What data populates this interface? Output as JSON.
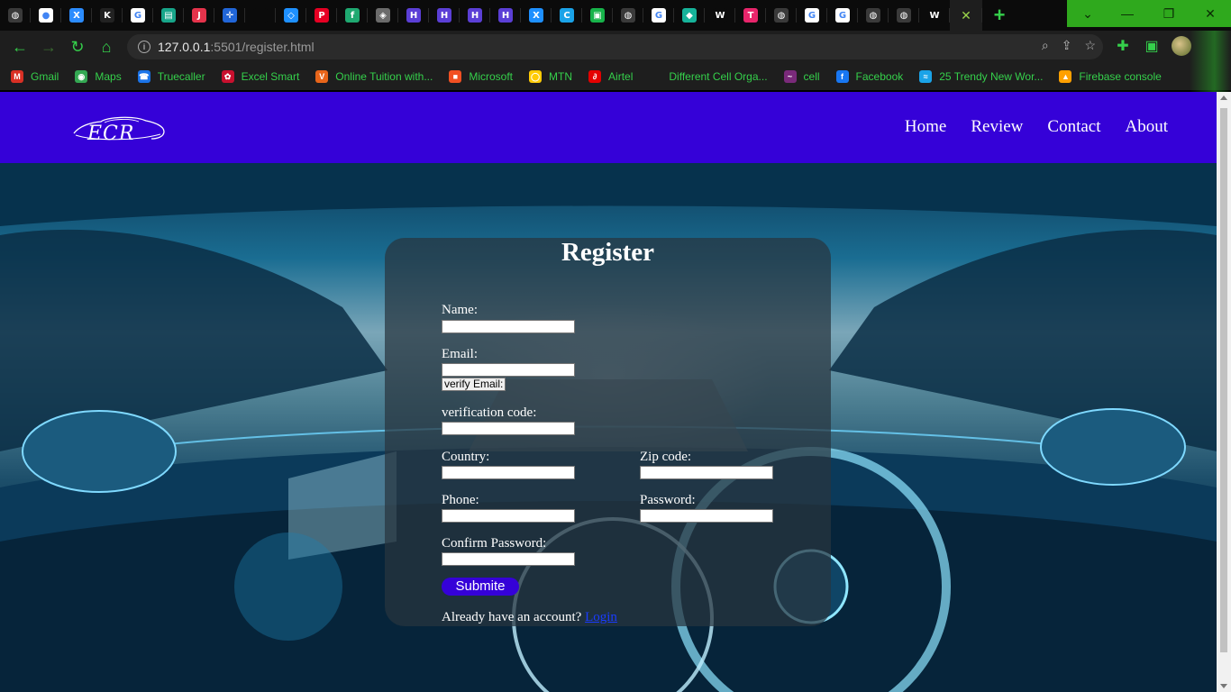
{
  "browser": {
    "tabs": [
      {
        "icon": "globe-icon",
        "color": "#3a3a3a",
        "glyph": "◍"
      },
      {
        "icon": "github-icon",
        "color": "#ffffff",
        "glyph": "●"
      },
      {
        "icon": "x-icon",
        "color": "#2b8cff",
        "glyph": "X"
      },
      {
        "icon": "k-icon",
        "color": "#222222",
        "glyph": "K"
      },
      {
        "icon": "google-icon",
        "color": "#ffffff",
        "glyph": "G"
      },
      {
        "icon": "sheet-icon",
        "color": "#17a589",
        "glyph": "▤"
      },
      {
        "icon": "j-icon",
        "color": "#e5334b",
        "glyph": "J"
      },
      {
        "icon": "jira-icon",
        "color": "#2166d8",
        "glyph": "✛"
      },
      {
        "icon": "blank-icon",
        "color": "#0b0b0b",
        "glyph": ""
      },
      {
        "icon": "code-icon",
        "color": "#1e90ff",
        "glyph": "◇"
      },
      {
        "icon": "pinterest-icon",
        "color": "#e60023",
        "glyph": "P"
      },
      {
        "icon": "fn-icon",
        "color": "#1fa971",
        "glyph": "f"
      },
      {
        "icon": "layers-icon",
        "color": "#6b6b6b",
        "glyph": "◈"
      },
      {
        "icon": "hashnode-icon",
        "color": "#5b3fd6",
        "glyph": "H"
      },
      {
        "icon": "hashnode-icon",
        "color": "#5b3fd6",
        "glyph": "H"
      },
      {
        "icon": "hashnode-icon",
        "color": "#5b3fd6",
        "glyph": "H"
      },
      {
        "icon": "hashnode-icon",
        "color": "#5b3fd6",
        "glyph": "H"
      },
      {
        "icon": "x-box-icon",
        "color": "#1e90ff",
        "glyph": "X"
      },
      {
        "icon": "c-icon",
        "color": "#1aa3e8",
        "glyph": "C"
      },
      {
        "icon": "green-box-icon",
        "color": "#17b34a",
        "glyph": "▣"
      },
      {
        "icon": "globe-icon",
        "color": "#3a3a3a",
        "glyph": "◍"
      },
      {
        "icon": "google-icon",
        "color": "#ffffff",
        "glyph": "G"
      },
      {
        "icon": "tag-icon",
        "color": "#16b39a",
        "glyph": "◆"
      },
      {
        "icon": "w-icon",
        "color": "#0b0b0b",
        "glyph": "W"
      },
      {
        "icon": "t-icon",
        "color": "#e8256b",
        "glyph": "T"
      },
      {
        "icon": "globe-icon",
        "color": "#3a3a3a",
        "glyph": "◍"
      },
      {
        "icon": "google-icon",
        "color": "#ffffff",
        "glyph": "G"
      },
      {
        "icon": "google-icon",
        "color": "#ffffff",
        "glyph": "G"
      },
      {
        "icon": "globe-icon",
        "color": "#3a3a3a",
        "glyph": "◍"
      },
      {
        "icon": "globe-icon",
        "color": "#3a3a3a",
        "glyph": "◍"
      },
      {
        "icon": "w-icon",
        "color": "#0b0b0b",
        "glyph": "W"
      }
    ],
    "address": {
      "host": "127.0.0.1",
      "rest": ":5501/register.html"
    },
    "bookmarks": [
      {
        "label": "Gmail",
        "icon": "gmail-icon",
        "color": "#d93025",
        "glyph": "M"
      },
      {
        "label": "Maps",
        "icon": "maps-icon",
        "color": "#34a853",
        "glyph": "◉"
      },
      {
        "label": "Truecaller",
        "icon": "truecaller-icon",
        "color": "#1a73e8",
        "glyph": "☎"
      },
      {
        "label": "Excel Smart",
        "icon": "huawei-icon",
        "color": "#c8102e",
        "glyph": "✿"
      },
      {
        "label": "Online Tuition with...",
        "icon": "v-icon",
        "color": "#e8651a",
        "glyph": "V"
      },
      {
        "label": "Microsoft",
        "icon": "microsoft-icon",
        "color": "#f25022",
        "glyph": "■"
      },
      {
        "label": "MTN",
        "icon": "mtn-icon",
        "color": "#ffcb05",
        "glyph": "◯"
      },
      {
        "label": "Airtel",
        "icon": "airtel-icon",
        "color": "#e40000",
        "glyph": "∂"
      },
      {
        "label": "Different Cell Orga...",
        "icon": "blank-icon",
        "color": "#1e1e1e",
        "glyph": ""
      },
      {
        "label": "cell",
        "icon": "cell-icon",
        "color": "#7a2a7a",
        "glyph": "~"
      },
      {
        "label": "Facebook",
        "icon": "facebook-icon",
        "color": "#1877f2",
        "glyph": "f"
      },
      {
        "label": "25 Trendy New Wor...",
        "icon": "wave-icon",
        "color": "#1aa3e8",
        "glyph": "≈"
      },
      {
        "label": "Firebase console",
        "icon": "firebase-icon",
        "color": "#ffa000",
        "glyph": "▲"
      }
    ]
  },
  "site": {
    "logo": "ECR",
    "nav": [
      "Home",
      "Review",
      "Contact",
      "About"
    ]
  },
  "form": {
    "title": "Register",
    "name_label": "Name:",
    "email_label": "Email:",
    "verify_button": "verify Email:",
    "code_label": "verification code:",
    "country_label": "Country:",
    "zip_label": "Zip code:",
    "phone_label": "Phone:",
    "password_label": "Password:",
    "confirm_label": "Confirm Password:",
    "submit_label": "Submite",
    "login_prompt": "Already have an account?",
    "login_link": "Login"
  }
}
